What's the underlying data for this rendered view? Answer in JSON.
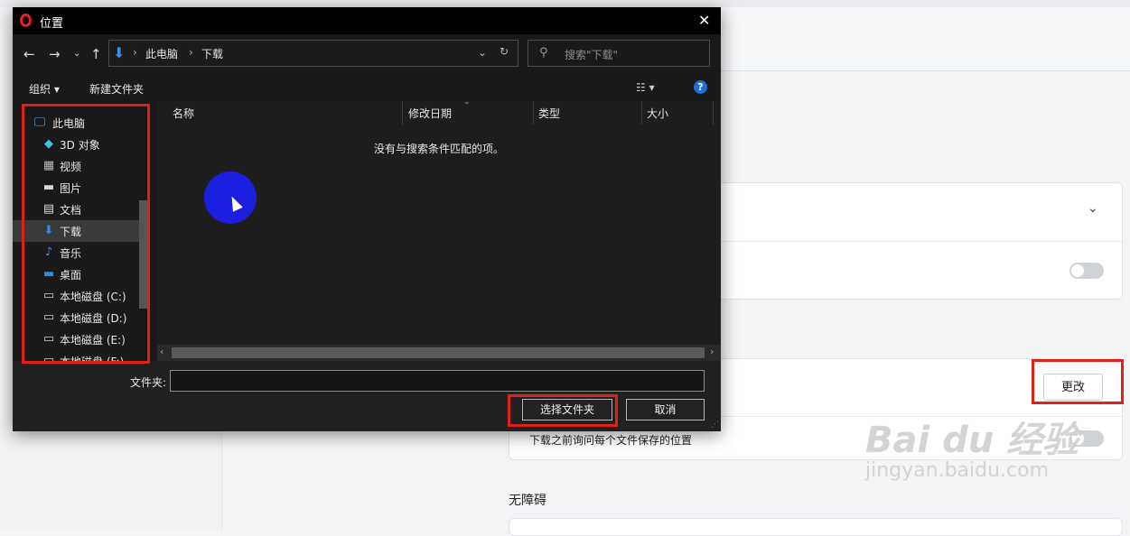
{
  "dialog": {
    "title": "位置",
    "address": {
      "root": "此电脑",
      "current": "下载"
    },
    "search_placeholder": "搜索\"下载\"",
    "toolbar": {
      "organize": "组织 ▾",
      "new_folder": "新建文件夹",
      "help": "?"
    },
    "nav_items": [
      {
        "label": "此电脑",
        "icon": "computer-icon"
      },
      {
        "label": "3D 对象",
        "icon": "cube-icon"
      },
      {
        "label": "视频",
        "icon": "video-icon"
      },
      {
        "label": "图片",
        "icon": "picture-icon"
      },
      {
        "label": "文档",
        "icon": "document-icon"
      },
      {
        "label": "下载",
        "icon": "download-icon",
        "selected": true
      },
      {
        "label": "音乐",
        "icon": "music-icon"
      },
      {
        "label": "桌面",
        "icon": "desktop-icon"
      },
      {
        "label": "本地磁盘 (C:)",
        "icon": "drive-icon"
      },
      {
        "label": "本地磁盘 (D:)",
        "icon": "drive-icon"
      },
      {
        "label": "本地磁盘 (E:)",
        "icon": "drive-icon"
      },
      {
        "label": "本地磁盘 (F:)",
        "icon": "drive-icon"
      }
    ],
    "columns": {
      "name": "名称",
      "date": "修改日期",
      "type": "类型",
      "size": "大小"
    },
    "empty_message": "没有与搜索条件匹配的项。",
    "folder_label": "文件夹:",
    "folder_value": "",
    "select_button": "选择文件夹",
    "cancel_button": "取消"
  },
  "settings": {
    "change_button": "更改",
    "ask_location_label": "下载之前询问每个文件保存的位置",
    "accessibility_heading": "无障碍"
  },
  "watermark": {
    "top": "Bai du 经验",
    "bottom": "jingyan.baidu.com"
  },
  "colors": {
    "highlight": "#e0201a",
    "accent": "#1e6fd9"
  }
}
